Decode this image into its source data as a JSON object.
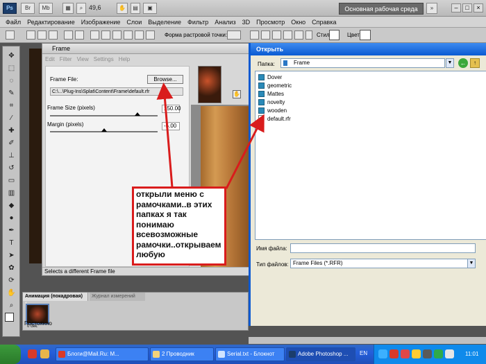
{
  "app": {
    "logo": "Ps",
    "zoom": "49,6",
    "workspace": "Основная рабочая среда"
  },
  "menu": [
    "Файл",
    "Редактирование",
    "Изображение",
    "Слои",
    "Выделение",
    "Фильтр",
    "Анализ",
    "3D",
    "Просмотр",
    "Окно",
    "Справка"
  ],
  "options_bar": {
    "raster_label": "Форма растровой точки:",
    "style_label": "Стиль:",
    "color_label": "Цвет:"
  },
  "frame_plugin": {
    "title": "Frame",
    "menu": [
      "Edit",
      "Filter",
      "View",
      "Settings",
      "Help"
    ],
    "frame_file_label": "Frame File:",
    "browse_label": "Browse...",
    "path": "C:\\...\\Plug-Ins\\Splat\\Content\\Frame\\default.rfr",
    "frame_size_label": "Frame Size (pixels)",
    "frame_size_value": "150.00",
    "frame_size_fraction": 0.81,
    "margin_label": "Margin (pixels)",
    "margin_value": "-5.00",
    "margin_fraction": 0.5,
    "status": "Selects a different Frame file"
  },
  "open_dialog": {
    "title": "Открыть",
    "folder_label": "Папка:",
    "folder_value": "Frame",
    "folders": [
      "Dover",
      "geometric",
      "Mattes",
      "novelty",
      "wooden"
    ],
    "files": [
      "default.rfr"
    ],
    "filename_label": "Имя файла:",
    "filename_value": "",
    "filetype_label": "Тип файлов:",
    "filetype_value": "Frame Files (*.RFR)"
  },
  "annotation": "открыли меню с рамочками..в этих папках я так понимаю всевозможные рамочки..открываем любую",
  "animation_panel": {
    "tab_active": "Анимация (покадровая)",
    "tab_inactive": "Журнал измерений",
    "frame_number": "1",
    "frame_delay": "0 сек.",
    "loop": "Постоянно"
  },
  "taskbar": {
    "items": [
      "Блоги@Mail.Ru: M...",
      "2 Проводник",
      "Serial.txt - Блокнот",
      "Adobe Photoshop ..."
    ],
    "lang": "EN",
    "clock": "11:01"
  },
  "colors": {
    "annotation_border": "#d91c1c",
    "xp_title": "#0a5ad2",
    "taskbar": "#245edb"
  }
}
